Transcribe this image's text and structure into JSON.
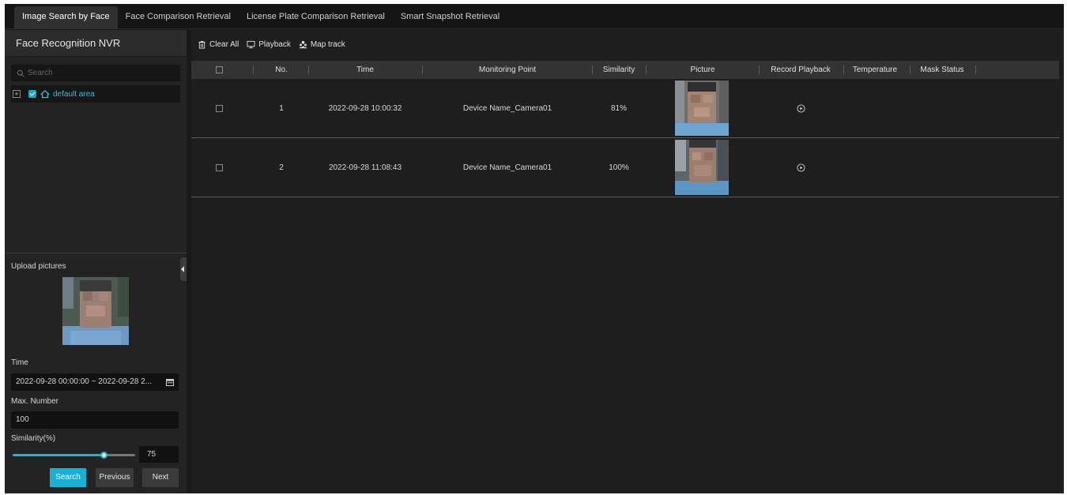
{
  "tabs": [
    {
      "label": "Image Search by Face",
      "active": true
    },
    {
      "label": "Face Comparison Retrieval",
      "active": false
    },
    {
      "label": "License Plate Comparison Retrieval",
      "active": false
    },
    {
      "label": "Smart Snapshot Retrieval",
      "active": false
    }
  ],
  "sidebar": {
    "title": "Face Recognition NVR",
    "search_placeholder": "Search",
    "tree": {
      "expander": "+",
      "label": "default area",
      "checked": true
    },
    "upload_label": "Upload pictures",
    "time_label": "Time",
    "time_value": "2022-09-28 00:00:00 ~ 2022-09-28 2...",
    "max_number_label": "Max. Number",
    "max_number_value": "100",
    "similarity_label": "Similarity(%)",
    "similarity_value": "75",
    "similarity_fraction": 0.75,
    "buttons": {
      "search": "Search",
      "previous": "Previous",
      "next": "Next"
    }
  },
  "toolbar": {
    "clear_all": "Clear All",
    "playback": "Playback",
    "map_track": "Map track"
  },
  "table": {
    "headers": {
      "no": "No.",
      "time": "Time",
      "monitoring_point": "Monitoring Point",
      "similarity": "Similarity",
      "picture": "Picture",
      "record_playback": "Record Playback",
      "temperature": "Temperature",
      "mask_status": "Mask Status"
    },
    "rows": [
      {
        "no": "1",
        "time": "2022-09-28 10:00:32",
        "monitoring_point": "Device Name_Camera01",
        "similarity": "81%"
      },
      {
        "no": "2",
        "time": "2022-09-28 11:08:43",
        "monitoring_point": "Device Name_Camera01",
        "similarity": "100%"
      }
    ]
  },
  "colors": {
    "accent": "#1ab0d6",
    "tree_label": "#2ec3e6",
    "background": "#191919"
  },
  "icons": {
    "search": "search-icon",
    "home": "home-icon",
    "calendar": "calendar-icon",
    "clear": "trash-icon",
    "playback": "monitor-icon",
    "map": "people-icon",
    "record": "play-circle-icon"
  }
}
